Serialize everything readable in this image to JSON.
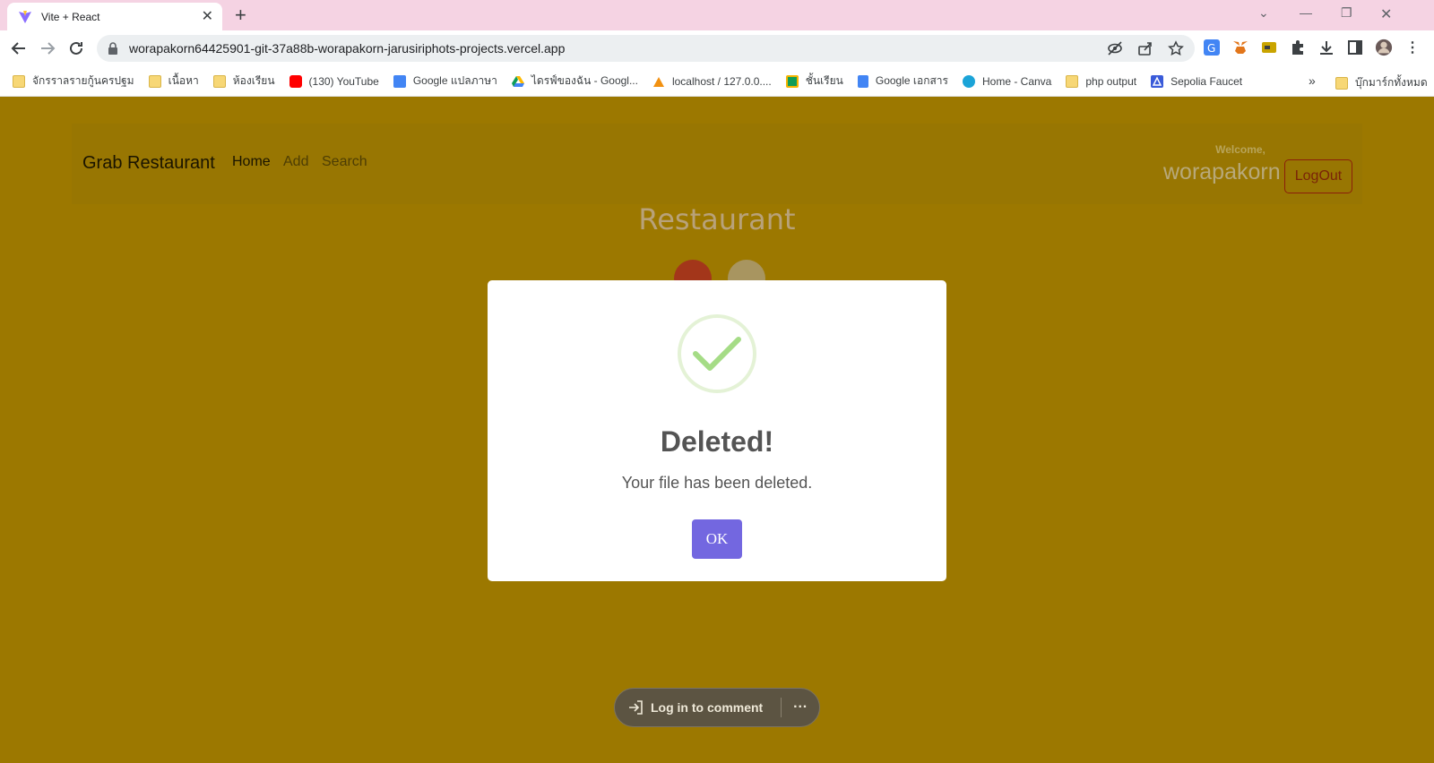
{
  "browser": {
    "tab_title": "Vite + React",
    "url": "worapakorn64425901-git-37a88b-worapakorn-jarusiriphots-projects.vercel.app",
    "bookmarks": [
      {
        "label": "จักรราลรายกู้นครปฐม",
        "icon": "folder-icon"
      },
      {
        "label": "เนื้อหา",
        "icon": "folder-icon"
      },
      {
        "label": "ห้องเรียน",
        "icon": "folder-icon"
      },
      {
        "label": "(130) YouTube",
        "icon": "youtube-icon"
      },
      {
        "label": "Google แปลภาษา",
        "icon": "translate-icon"
      },
      {
        "label": "ไดรฟ์ของฉัน - Googl...",
        "icon": "drive-icon"
      },
      {
        "label": "localhost / 127.0.0....",
        "icon": "phpmyadmin-icon"
      },
      {
        "label": "ชั้นเรียน",
        "icon": "classroom-icon"
      },
      {
        "label": "Google เอกสาร",
        "icon": "docs-icon"
      },
      {
        "label": "Home - Canva",
        "icon": "canva-icon"
      },
      {
        "label": "php output",
        "icon": "folder-icon"
      },
      {
        "label": "Sepolia Faucet",
        "icon": "alchemy-icon"
      }
    ],
    "more_bookmarks": "»",
    "all_bookmarks": "บุ๊กมาร์กทั้งหมด"
  },
  "navbar": {
    "brand": "Grab Restaurant",
    "links": [
      "Home",
      "Add",
      "Search"
    ],
    "welcome": "Welcome,",
    "username": "worapakorn",
    "logout": "LogOut"
  },
  "page": {
    "title": "Restaurant"
  },
  "modal": {
    "icon": "success-check-icon",
    "title": "Deleted!",
    "text": "Your file has been deleted.",
    "confirm": "OK",
    "accent_color": "#7367e0"
  },
  "comment_bar": {
    "label": "Log in to comment",
    "more": "···"
  },
  "colors": {
    "page_background": "#9c7800",
    "title_bar": "#f5d3e3"
  }
}
